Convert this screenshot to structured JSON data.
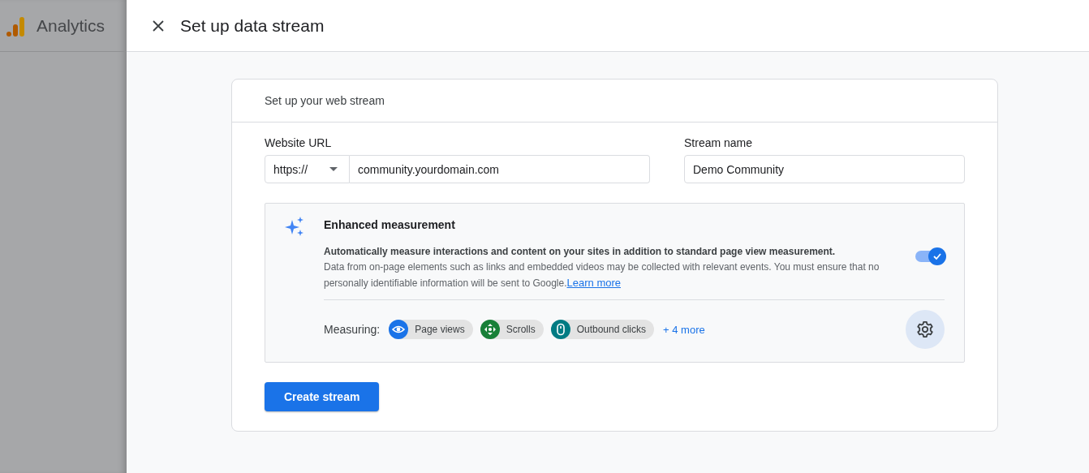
{
  "app": {
    "name": "Analytics"
  },
  "dialog": {
    "title": "Set up data stream",
    "card_title": "Set up your web stream",
    "website_url": {
      "label": "Website URL",
      "protocol": "https://",
      "value": "community.yourdomain.com"
    },
    "stream_name": {
      "label": "Stream name",
      "value": "Demo Community"
    },
    "enhanced": {
      "title": "Enhanced measurement",
      "lead": "Automatically measure interactions and content on your sites in addition to standard page view measurement.",
      "body": "Data from on-page elements such as links and embedded videos may be collected with relevant events. You must ensure that no personally identifiable information will be sent to Google.",
      "link": "Learn more",
      "on": true,
      "measuring_label": "Measuring:",
      "chips": [
        {
          "kind": "eye",
          "label": "Page views",
          "color": "#1a73e8"
        },
        {
          "kind": "scroll",
          "label": "Scrolls",
          "color": "#188038"
        },
        {
          "kind": "mouse",
          "label": "Outbound clicks",
          "color": "#007b83"
        }
      ],
      "more": "+ 4 more"
    },
    "button": "Create stream"
  }
}
